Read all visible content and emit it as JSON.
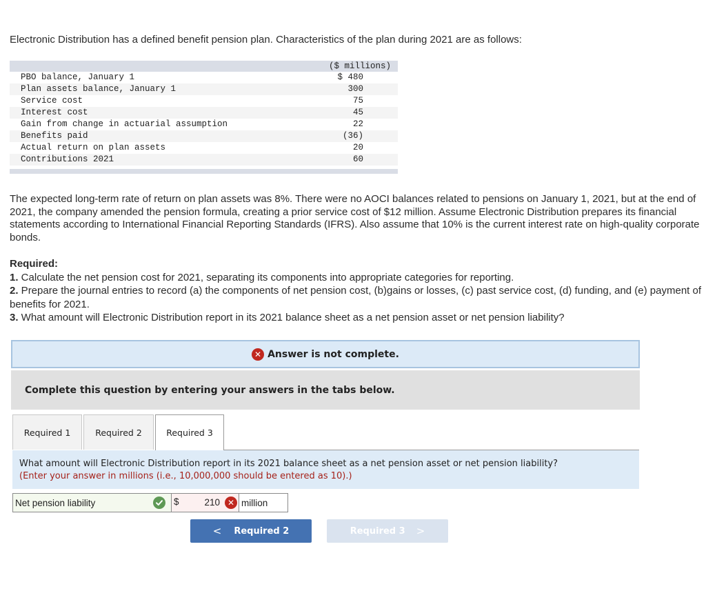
{
  "intro": "Electronic Distribution has a defined benefit pension plan. Characteristics of the plan during 2021 are as follows:",
  "table": {
    "header": "($ millions)",
    "rows": [
      {
        "label": "PBO balance, January 1",
        "value": "$ 480"
      },
      {
        "label": "Plan assets balance, January 1",
        "value": "300"
      },
      {
        "label": "Service cost",
        "value": "75"
      },
      {
        "label": "Interest cost",
        "value": "45"
      },
      {
        "label": "Gain from change in actuarial assumption",
        "value": "22"
      },
      {
        "label": "Benefits paid",
        "value": "(36)"
      },
      {
        "label": "Actual return on plan assets",
        "value": "20"
      },
      {
        "label": "Contributions 2021",
        "value": "60"
      }
    ]
  },
  "paragraph": "The expected long-term rate of return on plan assets was 8%. There were no AOCI balances related to pensions on January 1, 2021, but at the end of 2021, the company amended the pension formula, creating a prior service cost of $12 million. Assume Electronic Distribution prepares its financial statements according to International Financial Reporting Standards (IFRS). Also assume that 10% is the current interest rate on high-quality corporate bonds.",
  "required": {
    "heading": "Required:",
    "items": [
      {
        "num": "1.",
        "text": " Calculate the net pension cost for 2021, separating its components into appropriate categories for reporting."
      },
      {
        "num": "2.",
        "text": " Prepare the journal entries to record (a) the components of net pension cost, (b)gains or losses, (c) past service cost, (d) funding, and (e) payment of benefits for 2021."
      },
      {
        "num": "3.",
        "text": " What amount will Electronic Distribution report in its 2021 balance sheet as a net pension asset or net pension liability?"
      }
    ]
  },
  "banner": {
    "status_icon": "x-circle-icon",
    "text": "Answer is not complete."
  },
  "instructions": "Complete this question by entering your answers in the tabs below.",
  "tabs": [
    {
      "label": "Required 1",
      "active": false
    },
    {
      "label": "Required 2",
      "active": false
    },
    {
      "label": "Required 3",
      "active": true
    }
  ],
  "question": {
    "text": "What amount will Electronic Distribution report in its 2021 balance sheet as a net pension asset or net pension liability?",
    "hint": "(Enter your answer in millions (i.e., 10,000,000 should be entered as 10).)"
  },
  "answer": {
    "label": "Net pension liability",
    "label_status": "correct",
    "currency": "$",
    "value": "210",
    "value_status": "incorrect",
    "unit": "million"
  },
  "nav": {
    "prev_label": "Required 2",
    "next_label": "Required 3",
    "next_disabled": true
  },
  "colors": {
    "accent_blue": "#4472b2",
    "error_red": "#c0281f",
    "correct_green": "#5e9955",
    "hint_red": "#a5221a"
  }
}
